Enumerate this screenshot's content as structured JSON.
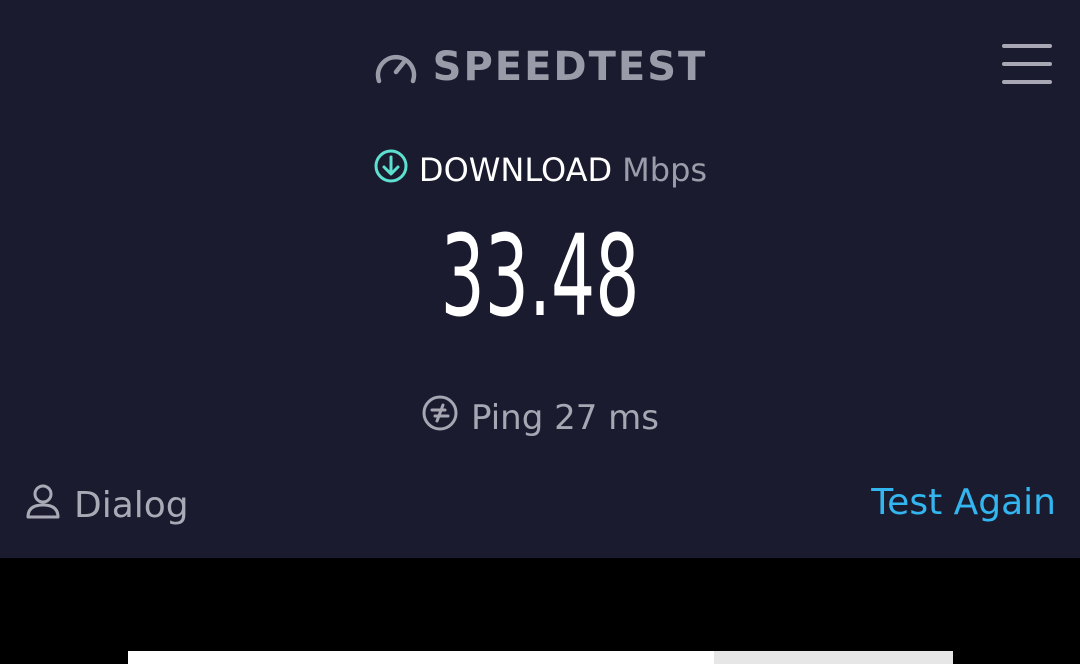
{
  "header": {
    "logo_text": "SPEEDTEST",
    "logo_icon": "speedometer-icon",
    "menu_icon": "hamburger-menu-icon"
  },
  "download": {
    "label": "DOWNLOAD",
    "unit": "Mbps",
    "value": "33.48",
    "icon": "download-arrow-icon"
  },
  "ping": {
    "text": "Ping 27 ms",
    "icon": "ping-icon"
  },
  "provider": {
    "name": "Dialog",
    "icon": "user-icon"
  },
  "actions": {
    "test_again": "Test Again"
  },
  "colors": {
    "background": "#1a1b2e",
    "accent": "#33b5f0",
    "download_icon": "#5ee0d0"
  }
}
